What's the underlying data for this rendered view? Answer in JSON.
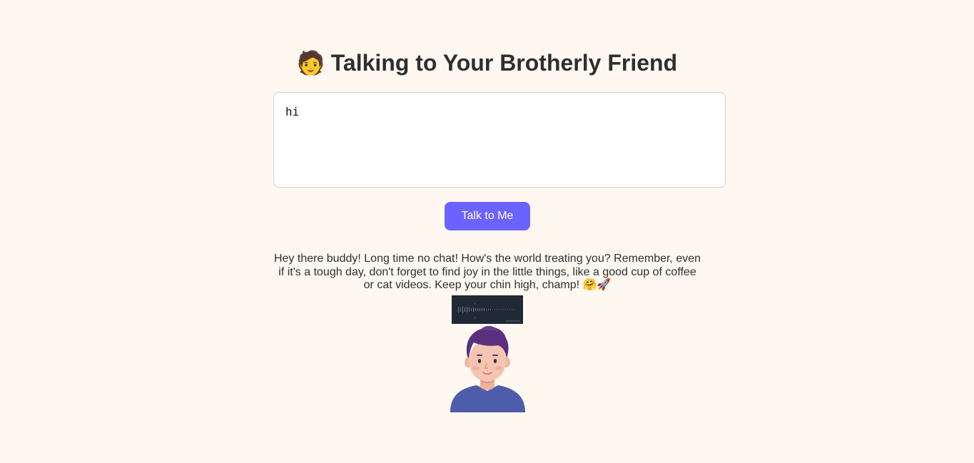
{
  "header": {
    "emoji": "🧑",
    "title": "Talking to Your Brotherly Friend"
  },
  "input": {
    "value": "hi"
  },
  "actions": {
    "talk_label": "Talk to Me"
  },
  "response": {
    "text": "Hey there buddy! Long time no chat! How's the world treating you? Remember, even if it's a tough day, don't forget to find joy in the little things, like a good cup of coffee or cat videos. Keep your chin high, champ! 🤗🚀"
  },
  "media": {
    "audio_icon": "audio-waveform-icon",
    "avatar_icon": "friend-avatar-icon"
  },
  "colors": {
    "background": "#fff8f1",
    "accent": "#6c63ff",
    "avatar_shirt": "#4d5cab",
    "avatar_hair": "#5a2f7d"
  }
}
